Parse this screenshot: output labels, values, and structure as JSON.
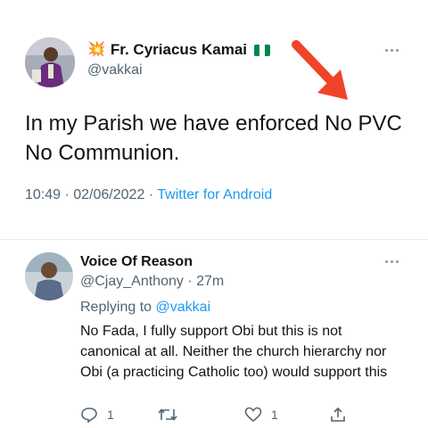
{
  "main_tweet": {
    "author_emoji": "💥",
    "author_name": "Fr. Cyriacus Kamai",
    "flag_name": "nigeria-flag",
    "handle": "@vakkai",
    "text": "In my Parish we have enforced No PVC No Communion.",
    "time": "10:49 · 02/06/2022 · ",
    "source": "Twitter for Android"
  },
  "reply": {
    "author_name": "Voice Of Reason",
    "handle": "@Cjay_Anthony",
    "age": " · 27m",
    "replying_prefix": "Replying to ",
    "replying_handle": "@vakkai",
    "text": "No Fada, I fully support Obi but this is not canonical at all. Neither the church hierarchy nor Obi (a practicing Catholic too) would support this",
    "actions": {
      "reply_count": "1",
      "retweet_count": "",
      "like_count": "1"
    }
  },
  "colors": {
    "accent": "#1d9bf0",
    "muted": "#536471",
    "arrow": "#f0442a",
    "nigeria_green": "#008751"
  }
}
